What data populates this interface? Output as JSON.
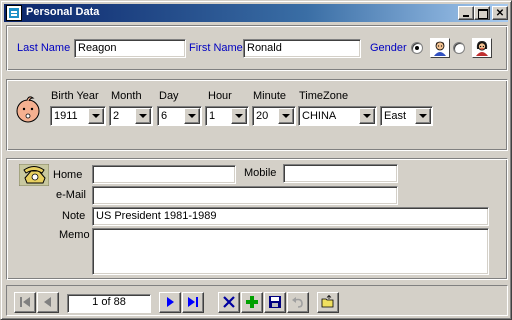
{
  "window": {
    "title": "Personal Data"
  },
  "name_row": {
    "last_name_label": "Last Name",
    "last_name_value": "Reagon",
    "first_name_label": "First Name",
    "first_name_value": "Ronald",
    "gender_label": "Gender",
    "gender_selected": "male"
  },
  "birth": {
    "year_label": "Birth Year",
    "month_label": "Month",
    "day_label": "Day",
    "hour_label": "Hour",
    "minute_label": "Minute",
    "timezone_label": "TimeZone",
    "year_value": "1911",
    "month_value": "2",
    "day_value": "6",
    "hour_value": "1",
    "minute_value": "20",
    "timezone_value": "CHINA",
    "direction_value": "East"
  },
  "contact": {
    "home_label": "Home",
    "home_value": "",
    "mobile_label": "Mobile",
    "mobile_value": "",
    "email_label": "e-Mail",
    "email_value": "",
    "note_label": "Note",
    "note_value": "US President 1981-1989",
    "memo_label": "Memo",
    "memo_value": ""
  },
  "navigator": {
    "record_position": "1 of 88"
  },
  "icons": {
    "app": "app-window-icon",
    "male": "male-face-icon",
    "female": "female-face-icon",
    "baby": "baby-face-icon",
    "phone": "telephone-icon",
    "first": "first-record-icon",
    "prev": "previous-record-icon",
    "next": "next-record-icon",
    "last": "last-record-icon",
    "delete": "delete-x-icon",
    "add": "add-plus-icon",
    "save": "save-disk-icon",
    "undo": "undo-icon",
    "open": "open-folder-icon"
  },
  "colors": {
    "title_gradient_start": "#0a246a",
    "title_gradient_end": "#a6caf0",
    "label_blue": "#0000c0",
    "nav_blue": "#0000ff",
    "add_green": "#00a000"
  }
}
